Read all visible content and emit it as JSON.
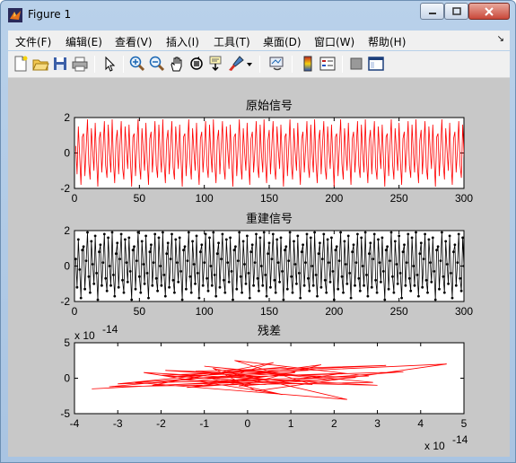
{
  "window": {
    "title": "Figure 1"
  },
  "menu": {
    "items": [
      "文件(F)",
      "编辑(E)",
      "查看(V)",
      "插入(I)",
      "工具(T)",
      "桌面(D)",
      "窗口(W)",
      "帮助(H)"
    ],
    "overflow_icon": "menu-arrow-icon"
  },
  "toolbar": {
    "icons": [
      "new-figure-icon",
      "open-icon",
      "save-icon",
      "print-icon",
      "select-arrow-icon",
      "zoom-in-icon",
      "zoom-out-icon",
      "pan-hand-icon",
      "rotate-3d-icon",
      "data-cursor-icon",
      "brush-icon",
      "brush-dropdown-icon",
      "link-plot-icon",
      "colorbar-icon",
      "legend-icon",
      "hide-plot-tools-icon",
      "show-plot-tools-icon"
    ]
  },
  "chart_data": [
    {
      "type": "line",
      "title": "原始信号",
      "xlim": [
        0,
        300
      ],
      "ylim": [
        -2,
        2
      ],
      "xticks": [
        "0",
        "50",
        "100",
        "150",
        "200",
        "250",
        "300"
      ],
      "yticks": [
        "2",
        "0",
        "-2"
      ],
      "color": "#ff0000",
      "series": [
        {
          "x_start": 1,
          "x_step": 1,
          "values": [
            0.4,
            -1.2,
            1.5,
            -0.2,
            -1.8,
            0.9,
            1.1,
            -1.3,
            0.3,
            1.9,
            -0.6,
            -1.5,
            1.4,
            0.1,
            -1.0,
            1.7,
            -0.4,
            -1.9,
            0.8,
            1.2,
            -1.1,
            0.2,
            1.8,
            -0.7,
            -1.4,
            1.6,
            0.0,
            -1.1,
            1.9,
            -0.5,
            -1.7,
            0.7,
            1.3,
            -1.2,
            0.4,
            1.8,
            -0.8,
            -1.5,
            1.5,
            0.2,
            -0.9,
            1.6,
            -0.3,
            -1.9,
            0.9,
            1.1,
            -1.3,
            0.3,
            1.9,
            -0.6,
            -1.5,
            1.4,
            0.1,
            -1.0,
            1.7,
            -0.4,
            -1.8,
            0.8,
            1.2,
            -1.1,
            0.2,
            1.8,
            -0.7,
            -1.4,
            1.6,
            0.0,
            -1.1,
            1.9,
            -0.5,
            -1.7,
            0.7,
            1.3,
            -1.2,
            0.4,
            1.8,
            -0.8,
            -1.5,
            1.5,
            0.2,
            -0.9,
            1.6,
            -0.3,
            -1.9,
            0.9,
            1.1,
            -1.3,
            0.3,
            1.9,
            -0.6,
            -1.5,
            1.4,
            0.1,
            -1.0,
            1.7,
            -0.4,
            -1.8,
            0.8,
            1.2,
            -1.1,
            0.2,
            1.8,
            -0.7,
            -1.4,
            1.6,
            0.0,
            -1.1,
            1.9,
            -0.5,
            -1.7,
            0.7,
            1.3,
            -1.2,
            0.4,
            1.8,
            -0.8,
            -1.5,
            1.5,
            0.2,
            -0.9,
            1.6,
            -0.3,
            -1.9,
            0.9,
            1.1,
            -1.3,
            0.3,
            1.9,
            -0.6,
            -1.5,
            1.4,
            0.1,
            -1.0,
            1.7,
            -0.4,
            -1.8,
            0.8,
            1.2,
            -1.1,
            0.2,
            1.8,
            -0.7,
            -1.4,
            1.6,
            0.0,
            -1.1,
            1.9,
            -0.5,
            -1.7,
            0.7,
            1.3,
            -1.2,
            0.4,
            1.8,
            -0.8,
            -1.5,
            1.5,
            0.2,
            -0.9,
            1.6,
            -0.3,
            -1.9,
            0.9,
            1.1,
            -1.3,
            0.3,
            1.9,
            -0.6,
            -1.5,
            1.4,
            0.1,
            -1.0,
            1.7,
            -0.4,
            -1.8,
            0.8,
            1.2,
            -1.1,
            0.2,
            1.8,
            -0.7,
            -1.4,
            1.6,
            0.0,
            -1.1,
            1.9,
            -0.5,
            -1.7,
            0.7,
            1.3,
            -1.2,
            0.4,
            1.8,
            -0.8,
            -1.5,
            1.5,
            0.2,
            -0.9,
            1.6,
            -0.3,
            -1.9,
            0.9,
            1.1,
            -1.3,
            0.3,
            1.9,
            -0.6,
            -1.5,
            1.4,
            0.1,
            -1.0,
            1.7,
            -0.4,
            -1.8,
            0.8,
            1.2,
            -1.1,
            0.2,
            1.8,
            -0.7,
            -1.4,
            1.6,
            0.0,
            -1.1,
            1.9,
            -0.5,
            -1.7,
            0.7,
            1.3,
            -1.2,
            0.4,
            1.8,
            -0.8,
            -1.5,
            1.5,
            0.2,
            -0.9,
            1.6,
            -0.3,
            -1.9,
            0.9,
            1.1,
            -1.3,
            0.3,
            1.9,
            -0.6,
            -1.5,
            1.4,
            0.1,
            -1.0,
            1.7,
            -0.4,
            -1.8,
            0.8,
            1.2,
            -1.1,
            0.2,
            1.8,
            -0.7,
            -1.4,
            1.6,
            0.0,
            -1.1,
            1.9,
            -0.5,
            -1.7,
            0.7,
            1.3,
            -1.2,
            0.4,
            1.8,
            -0.8,
            -1.5,
            1.5,
            0.2,
            -0.9,
            1.6,
            -0.3,
            -1.9,
            0.9,
            1.1,
            -1.3,
            0.3,
            1.9,
            -0.6,
            -1.5,
            1.4,
            0.1,
            -1.0,
            1.7,
            -0.4,
            -1.8,
            0.8,
            1.2,
            -1.1,
            0.2,
            1.8,
            -0.7,
            -1.4,
            1.6,
            0.0,
            -1.1,
            1.9,
            -0.5,
            -1.7,
            0.7,
            1.3,
            -1.2,
            0.4,
            1.8,
            -0.8,
            -1.5,
            1.5,
            0.2,
            -0.9,
            1.6,
            -0.3,
            -1.9,
            0.9,
            1.1,
            -1.3,
            0.3,
            1.9,
            -0.6,
            -1.5,
            1.4,
            0.1,
            -1.0,
            1.7,
            -0.4,
            -1.8,
            2.0
          ]
        }
      ]
    },
    {
      "type": "line",
      "title": "重建信号",
      "xlim": [
        0,
        300
      ],
      "ylim": [
        -2,
        2
      ],
      "xticks": [
        "0",
        "50",
        "100",
        "150",
        "200",
        "250",
        "300"
      ],
      "yticks": [
        "2",
        "0",
        "-2"
      ],
      "color": "#000000",
      "marker": "dot",
      "series": [
        {
          "x_start": 1,
          "x_step": 1,
          "values_same_as": "原始信号"
        }
      ]
    },
    {
      "type": "line",
      "title": "残差",
      "xlim": [
        -4,
        5
      ],
      "ylim": [
        -5,
        5
      ],
      "x_exponent_label": "x 10^-14",
      "y_exponent_label": "x 10^-14",
      "xticks": [
        "-4",
        "-3",
        "-2",
        "-1",
        "0",
        "1",
        "2",
        "3",
        "4",
        "5"
      ],
      "yticks": [
        "5",
        "0",
        "-5"
      ],
      "color": "#ff0000",
      "series": [
        {
          "points": [
            [
              -3.6,
              -1.5
            ],
            [
              0.5,
              -0.2
            ],
            [
              -1.2,
              1.0
            ],
            [
              3.2,
              1.8
            ],
            [
              -2.0,
              0.4
            ],
            [
              1.5,
              -0.9
            ],
            [
              -0.3,
              2.5
            ],
            [
              2.8,
              0.3
            ],
            [
              -3.0,
              -0.8
            ],
            [
              0.9,
              1.6
            ],
            [
              -1.8,
              0.2
            ],
            [
              4.6,
              2.0
            ],
            [
              0.2,
              -1.8
            ],
            [
              -0.8,
              1.4
            ],
            [
              2.3,
              -3.0
            ],
            [
              -2.6,
              -0.6
            ],
            [
              1.1,
              0.8
            ],
            [
              -1.4,
              -1.3
            ],
            [
              3.6,
              0.9
            ],
            [
              -0.5,
              0.1
            ],
            [
              0.6,
              2.2
            ],
            [
              -2.2,
              -1.0
            ],
            [
              1.9,
              -0.2
            ],
            [
              -1.0,
              1.7
            ],
            [
              2.9,
              -0.6
            ],
            [
              -3.2,
              -1.2
            ],
            [
              0.0,
              0.6
            ],
            [
              1.4,
              1.2
            ],
            [
              -1.6,
              -0.2
            ],
            [
              0.4,
              -0.9
            ],
            [
              2.2,
              0.7
            ],
            [
              -0.9,
              0.0
            ],
            [
              0.8,
              -2.3
            ],
            [
              -2.4,
              0.8
            ],
            [
              3.0,
              -1.0
            ],
            [
              -1.2,
              -0.4
            ],
            [
              1.7,
              1.9
            ],
            [
              -0.2,
              -1.1
            ],
            [
              2.5,
              0.1
            ],
            [
              -1.9,
              1.1
            ],
            [
              0.3,
              0.2
            ],
            [
              -0.6,
              -0.5
            ]
          ]
        }
      ]
    }
  ]
}
